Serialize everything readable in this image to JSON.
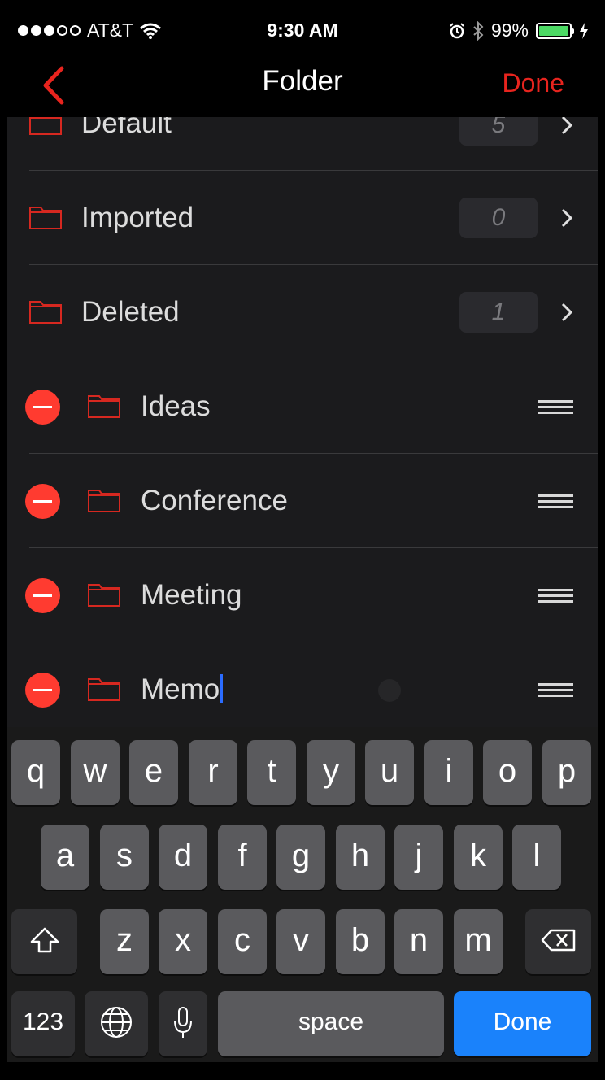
{
  "status_bar": {
    "carrier": "AT&T",
    "time": "9:30 AM",
    "battery": "99%",
    "battery_level": 0.99,
    "signal_bars_filled": 3,
    "signal_bars_total": 5
  },
  "nav": {
    "title": "Folder",
    "done_label": "Done"
  },
  "folders_fixed": [
    {
      "name": "Default",
      "count": "5"
    },
    {
      "name": "Imported",
      "count": "0"
    },
    {
      "name": "Deleted",
      "count": "1"
    }
  ],
  "folders_editable": [
    {
      "name": "Ideas"
    },
    {
      "name": "Conference"
    },
    {
      "name": "Meeting"
    },
    {
      "name": "Memo"
    }
  ],
  "keyboard": {
    "row1": [
      "q",
      "w",
      "e",
      "r",
      "t",
      "y",
      "u",
      "i",
      "o",
      "p"
    ],
    "row2": [
      "a",
      "s",
      "d",
      "f",
      "g",
      "h",
      "j",
      "k",
      "l"
    ],
    "row3": [
      "z",
      "x",
      "c",
      "v",
      "b",
      "n",
      "m"
    ],
    "numbers_label": "123",
    "space_label": "space",
    "return_label": "Done"
  },
  "colors": {
    "accent": "#e8241e",
    "delete_red": "#ff3b30",
    "return_blue": "#1a82fb",
    "list_bg": "#1b1b1d",
    "battery_green": "#4cd964"
  }
}
